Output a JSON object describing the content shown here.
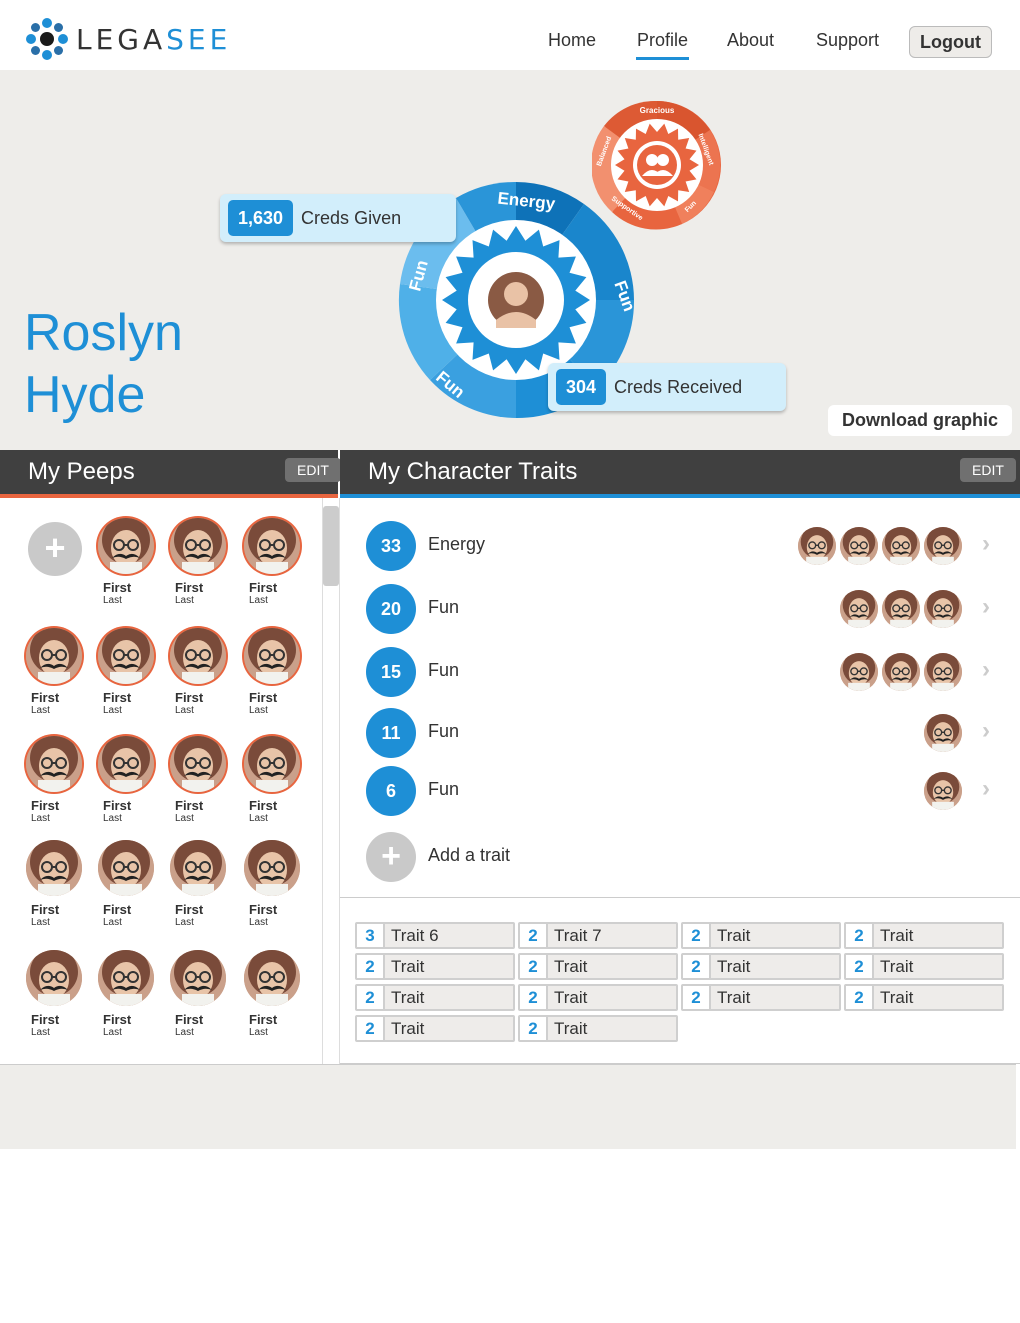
{
  "brand": {
    "logo_prefix": "LEGA",
    "logo_suffix": "SEE"
  },
  "nav": {
    "home": "Home",
    "profile": "Profile",
    "about": "About",
    "support": "Support",
    "logout": "Logout"
  },
  "profile": {
    "first_name": "Roslyn",
    "last_name": "Hyde",
    "creds_given_value": "1,630",
    "creds_given_label": "Creds Given",
    "creds_received_value": "304",
    "creds_received_label": "Creds Received",
    "download_label": "Download graphic",
    "wheel_segments": [
      "Energy",
      "Fun",
      "Fun",
      "Fun"
    ],
    "badge_segments": [
      "Gracious",
      "Intelligent",
      "Fun",
      "Supportive",
      "Balanced"
    ]
  },
  "peeps": {
    "title": "My Peeps",
    "edit_label": "EDIT",
    "add_label": "+",
    "first": "First",
    "last": "Last"
  },
  "traits": {
    "title": "My Character Traits",
    "edit_label": "EDIT",
    "add_label": "Add a trait",
    "add_icon": "+",
    "rows": [
      {
        "count": "33",
        "name": "Energy",
        "avatars": 4
      },
      {
        "count": "20",
        "name": "Fun",
        "avatars": 3
      },
      {
        "count": "15",
        "name": "Fun",
        "avatars": 3
      },
      {
        "count": "11",
        "name": "Fun",
        "avatars": 1
      },
      {
        "count": "6",
        "name": "Fun",
        "avatars": 1
      }
    ],
    "chevron": "›"
  },
  "trait_chips": [
    {
      "count": "3",
      "name": "Trait 6"
    },
    {
      "count": "2",
      "name": "Trait 7"
    },
    {
      "count": "2",
      "name": "Trait"
    },
    {
      "count": "2",
      "name": "Trait"
    },
    {
      "count": "2",
      "name": "Trait"
    },
    {
      "count": "2",
      "name": "Trait"
    },
    {
      "count": "2",
      "name": "Trait"
    },
    {
      "count": "2",
      "name": "Trait"
    },
    {
      "count": "2",
      "name": "Trait"
    },
    {
      "count": "2",
      "name": "Trait"
    },
    {
      "count": "2",
      "name": "Trait"
    },
    {
      "count": "2",
      "name": "Trait"
    },
    {
      "count": "2",
      "name": "Trait"
    },
    {
      "count": "2",
      "name": "Trait"
    }
  ],
  "colors": {
    "accent_blue": "#1e8fd6",
    "accent_orange": "#e8653f",
    "bar_dark": "#404040",
    "hero_bg": "#eeedea"
  }
}
